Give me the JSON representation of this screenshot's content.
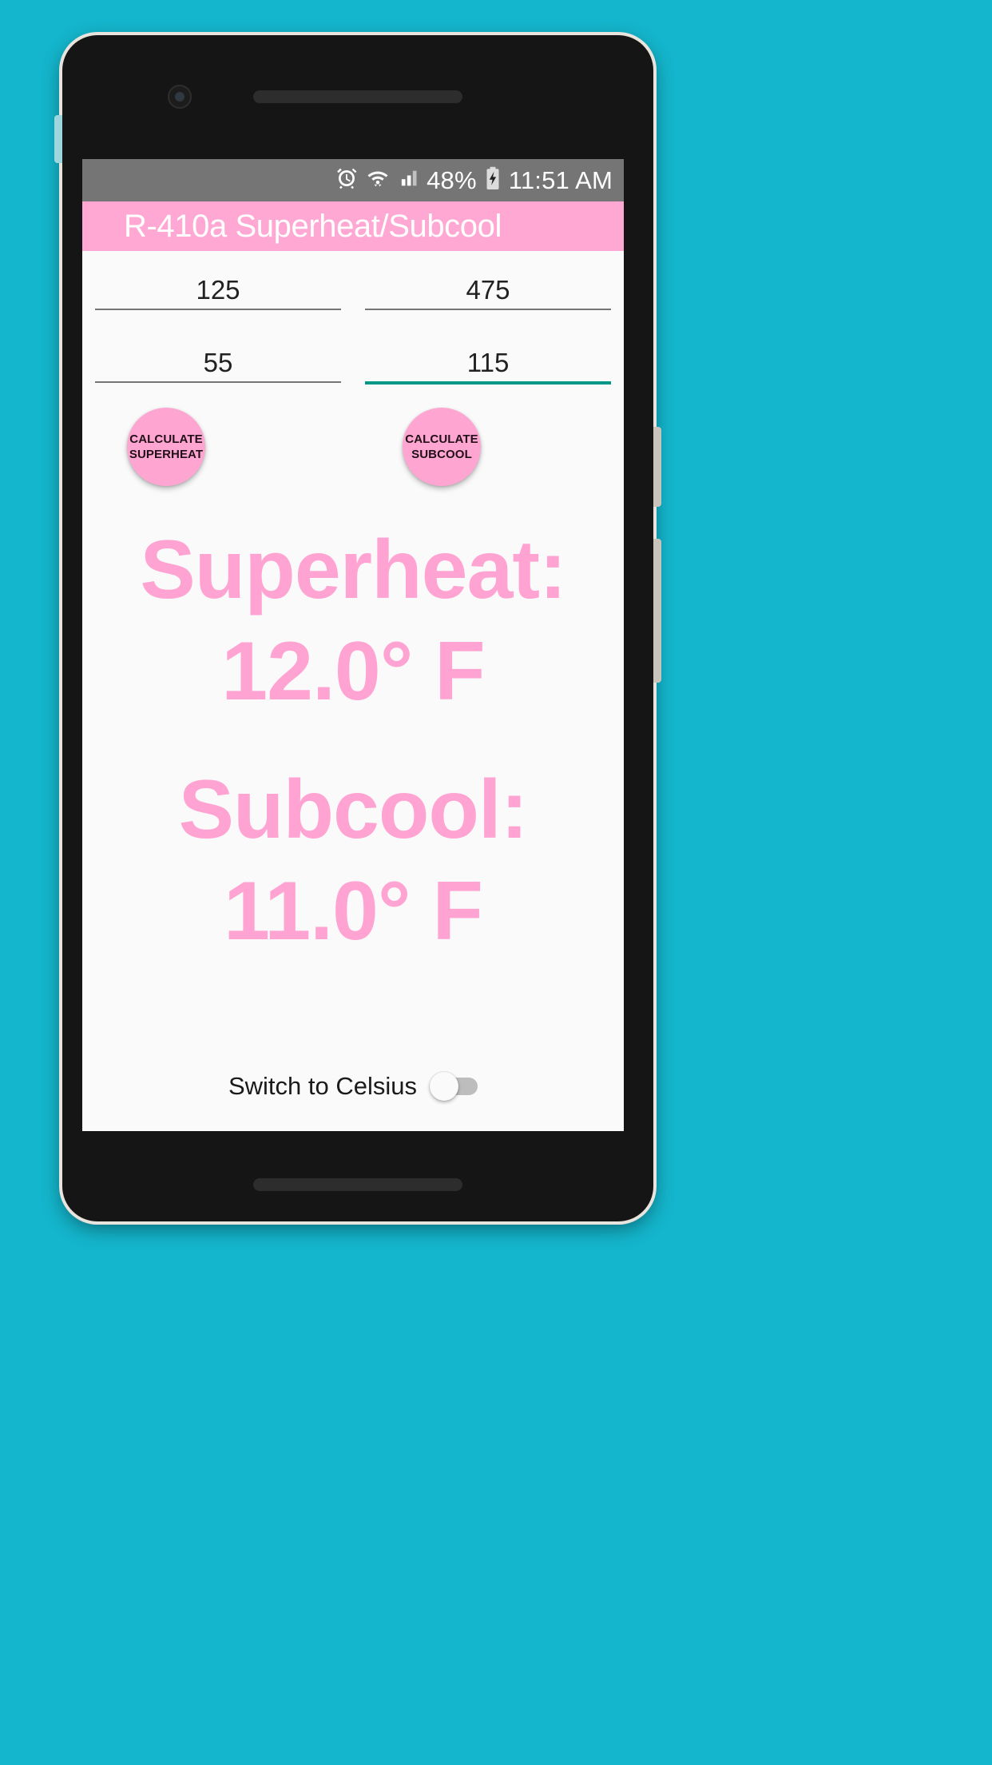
{
  "status_bar": {
    "icons": [
      "alarm-icon",
      "wifi-icon",
      "signal-icon",
      "battery-charging-icon"
    ],
    "battery_percent": "48%",
    "time": "11:51 AM"
  },
  "app_bar": {
    "title": "R-410a Superheat/Subcool",
    "background": "#ffa8d3",
    "title_color": "#ffffff"
  },
  "inputs": {
    "row1": [
      {
        "name": "suction-pressure",
        "value": "125",
        "focused": false
      },
      {
        "name": "liquid-pressure",
        "value": "475",
        "focused": false
      }
    ],
    "row2": [
      {
        "name": "suction-line-temp",
        "value": "55",
        "focused": false
      },
      {
        "name": "liquid-line-temp",
        "value": "115",
        "focused": true
      }
    ]
  },
  "buttons": {
    "superheat": {
      "line1": "CALCULATE",
      "line2": "SUPERHEAT"
    },
    "subcool": {
      "line1": "CALCULATE",
      "line2": "SUBCOOL"
    }
  },
  "results": {
    "superheat": {
      "label": "Superheat:",
      "value": "12.0° F"
    },
    "subcool": {
      "label": "Subcool:",
      "value": "11.0° F"
    },
    "color": "#ffa4d2"
  },
  "unit_switch": {
    "label": "Switch to Celsius",
    "state": "off"
  },
  "colors": {
    "backdrop": "#14b6cd",
    "accent_pink": "#ffa5d2",
    "focus_teal": "#009688",
    "screen_bg": "#fafafa"
  }
}
